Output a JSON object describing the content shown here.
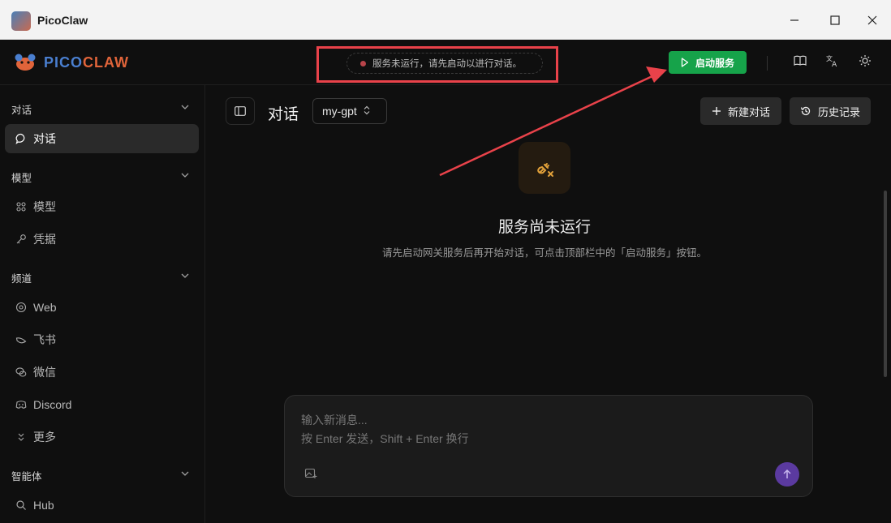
{
  "window": {
    "title": "PicoClaw",
    "controls": [
      "minimize-icon",
      "maximize-icon",
      "close-icon"
    ]
  },
  "header": {
    "logo_text_left": "PICO",
    "logo_text_right": "CLAW",
    "status_text": "服务未运行，请先启动以进行对话。",
    "start_button_label": "启动服务",
    "icons": [
      "book-icon",
      "translate-icon",
      "sun-icon"
    ]
  },
  "sidebar": {
    "sections": [
      {
        "title": "对话",
        "items": [
          {
            "label": "对话",
            "icon": "chat-icon",
            "active": true
          }
        ]
      },
      {
        "title": "模型",
        "items": [
          {
            "label": "模型",
            "icon": "model-icon"
          },
          {
            "label": "凭据",
            "icon": "key-icon"
          }
        ]
      },
      {
        "title": "频道",
        "items": [
          {
            "label": "Web",
            "icon": "globe-icon"
          },
          {
            "label": "飞书",
            "icon": "feishu-icon"
          },
          {
            "label": "微信",
            "icon": "wechat-icon"
          },
          {
            "label": "Discord",
            "icon": "discord-icon"
          },
          {
            "label": "更多",
            "icon": "chevrons-down-icon"
          }
        ]
      },
      {
        "title": "智能体",
        "items": [
          {
            "label": "Hub",
            "icon": "search-icon"
          }
        ]
      }
    ]
  },
  "main": {
    "title": "对话",
    "model_select": "my-gpt",
    "new_chat_label": "新建对话",
    "history_label": "历史记录",
    "empty_title": "服务尚未运行",
    "empty_desc": "请先启动网关服务后再开始对话，可点击顶部栏中的「启动服务」按钮。",
    "composer_placeholder_line1": "输入新消息...",
    "composer_placeholder_line2": "按 Enter 发送，Shift + Enter 换行"
  },
  "colors": {
    "accent_green": "#16a34a",
    "annotation_red": "#e9424a",
    "send_purple": "#5b3aa0",
    "plug_orange": "#e0a03a",
    "status_dot": "#b8444a"
  }
}
